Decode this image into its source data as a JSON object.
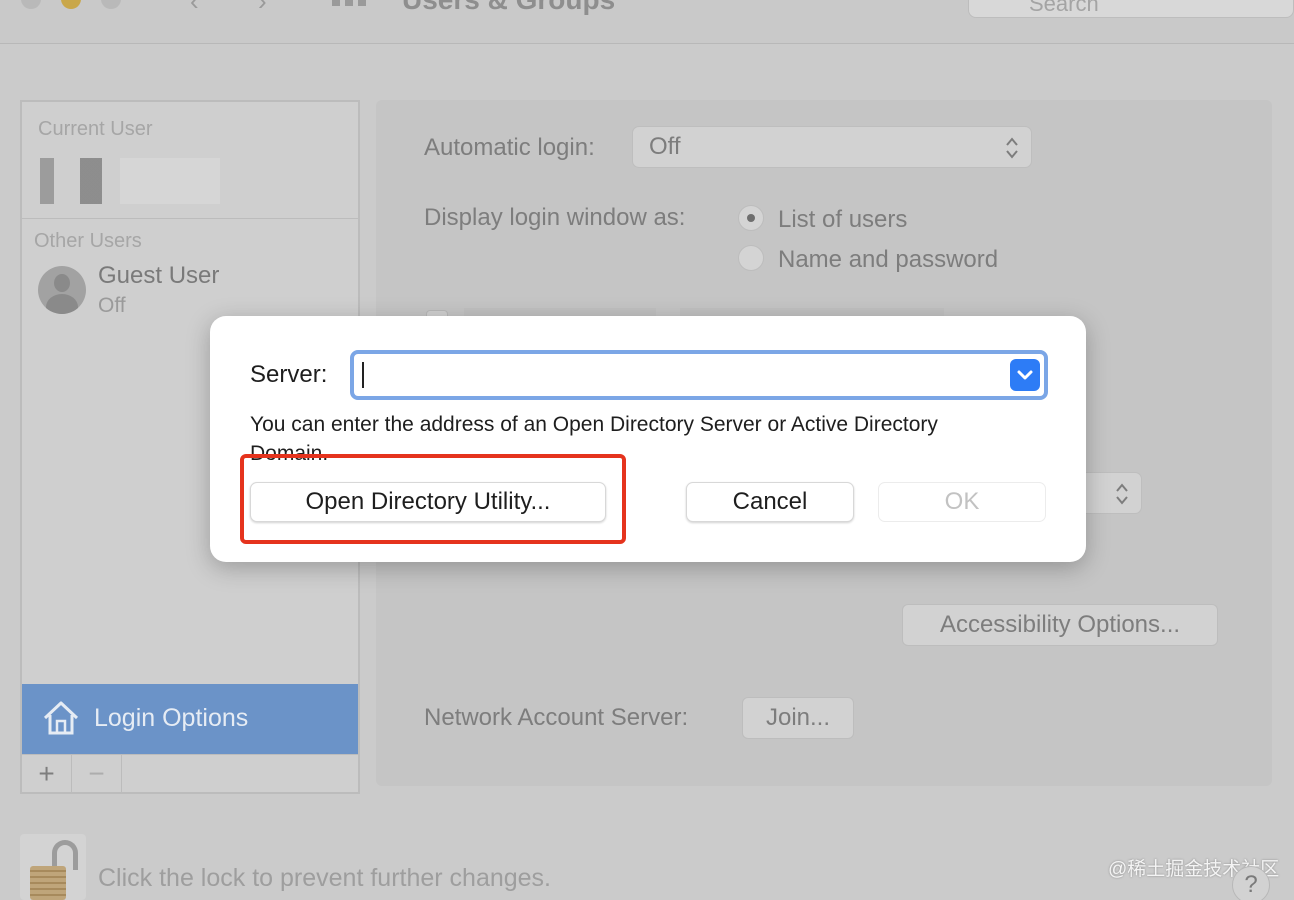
{
  "window": {
    "title": "Users & Groups",
    "search_placeholder": "Search"
  },
  "sidebar": {
    "current_user_label": "Current User",
    "other_users_label": "Other Users",
    "guest": {
      "name": "Guest User",
      "status": "Off"
    },
    "login_options_label": "Login Options",
    "add_symbol": "+",
    "remove_symbol": "−"
  },
  "login_options": {
    "automatic_login_label": "Automatic login:",
    "automatic_login_value": "Off",
    "display_as_label": "Display login window as:",
    "display_options": [
      "List of users",
      "Name and password"
    ],
    "display_selected": "List of users",
    "accessibility_button": "Accessibility Options...",
    "network_server_label": "Network Account Server:",
    "join_button": "Join..."
  },
  "lock": {
    "text": "Click the lock to prevent further changes."
  },
  "help_symbol": "?",
  "watermark": "@稀土掘金技术社区",
  "dialog": {
    "server_label": "Server:",
    "server_value": "",
    "description": "You can enter the address of an Open Directory Server or Active Directory Domain.",
    "open_directory_button": "Open Directory Utility...",
    "cancel_button": "Cancel",
    "ok_button": "OK",
    "ok_enabled": false
  },
  "colors": {
    "accent": "#2d7cf6",
    "selection": "#6b93c8",
    "highlight": "#e5331d"
  }
}
